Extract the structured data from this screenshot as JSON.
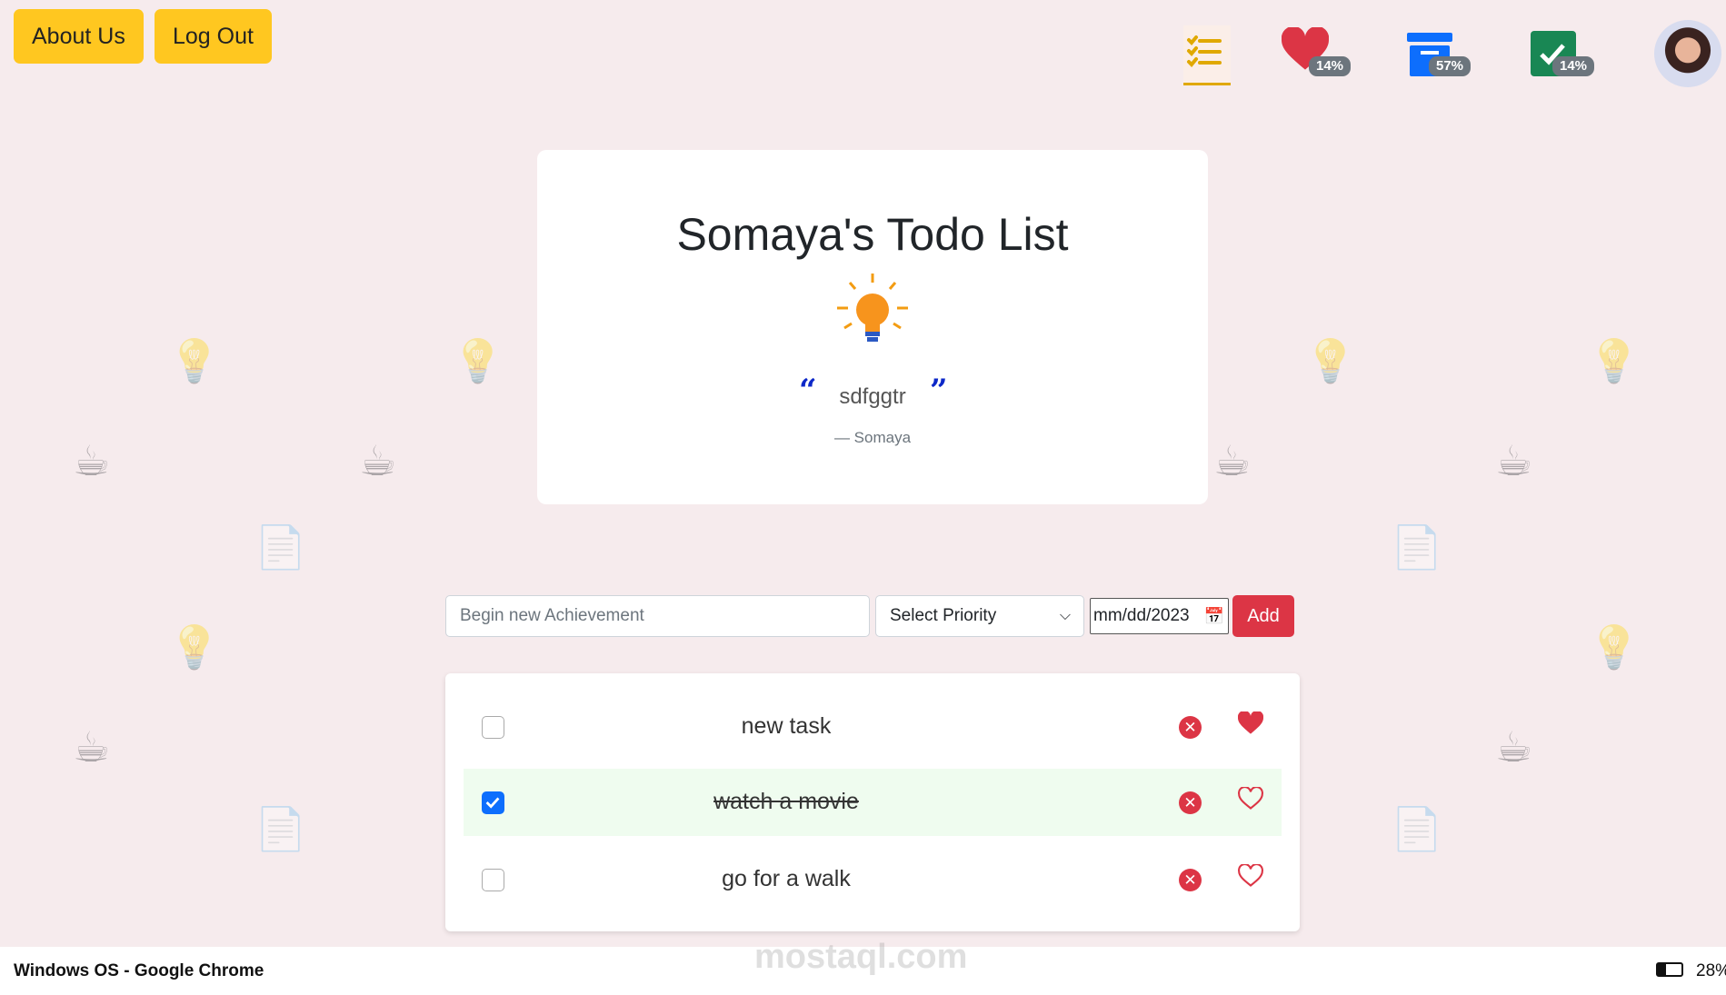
{
  "header": {
    "about_label": "About Us",
    "logout_label": "Log Out",
    "stats": [
      {
        "icon": "heart-icon",
        "badge": "14%",
        "color": "#dc3545"
      },
      {
        "icon": "archive-icon",
        "badge": "57%",
        "color": "#0d6efd"
      },
      {
        "icon": "check-square-icon",
        "badge": "14%",
        "color": "#198754"
      }
    ],
    "list_icon_color": "#e0a800"
  },
  "card": {
    "title": "Somaya's Todo List",
    "quote": "sdfggtr",
    "author": "— Somaya"
  },
  "form": {
    "placeholder": "Begin new Achievement",
    "priority": "Select Priority",
    "date": "mm/dd/2023",
    "add_label": "Add"
  },
  "todos": [
    {
      "text": "new task",
      "done": false,
      "favorite": true
    },
    {
      "text": "watch a movie",
      "done": true,
      "favorite": false
    },
    {
      "text": "go for a walk",
      "done": false,
      "favorite": false
    }
  ],
  "footer": {
    "title": "Windows OS - Google Chrome",
    "battery": "28%",
    "watermark": "mostaql.com"
  }
}
